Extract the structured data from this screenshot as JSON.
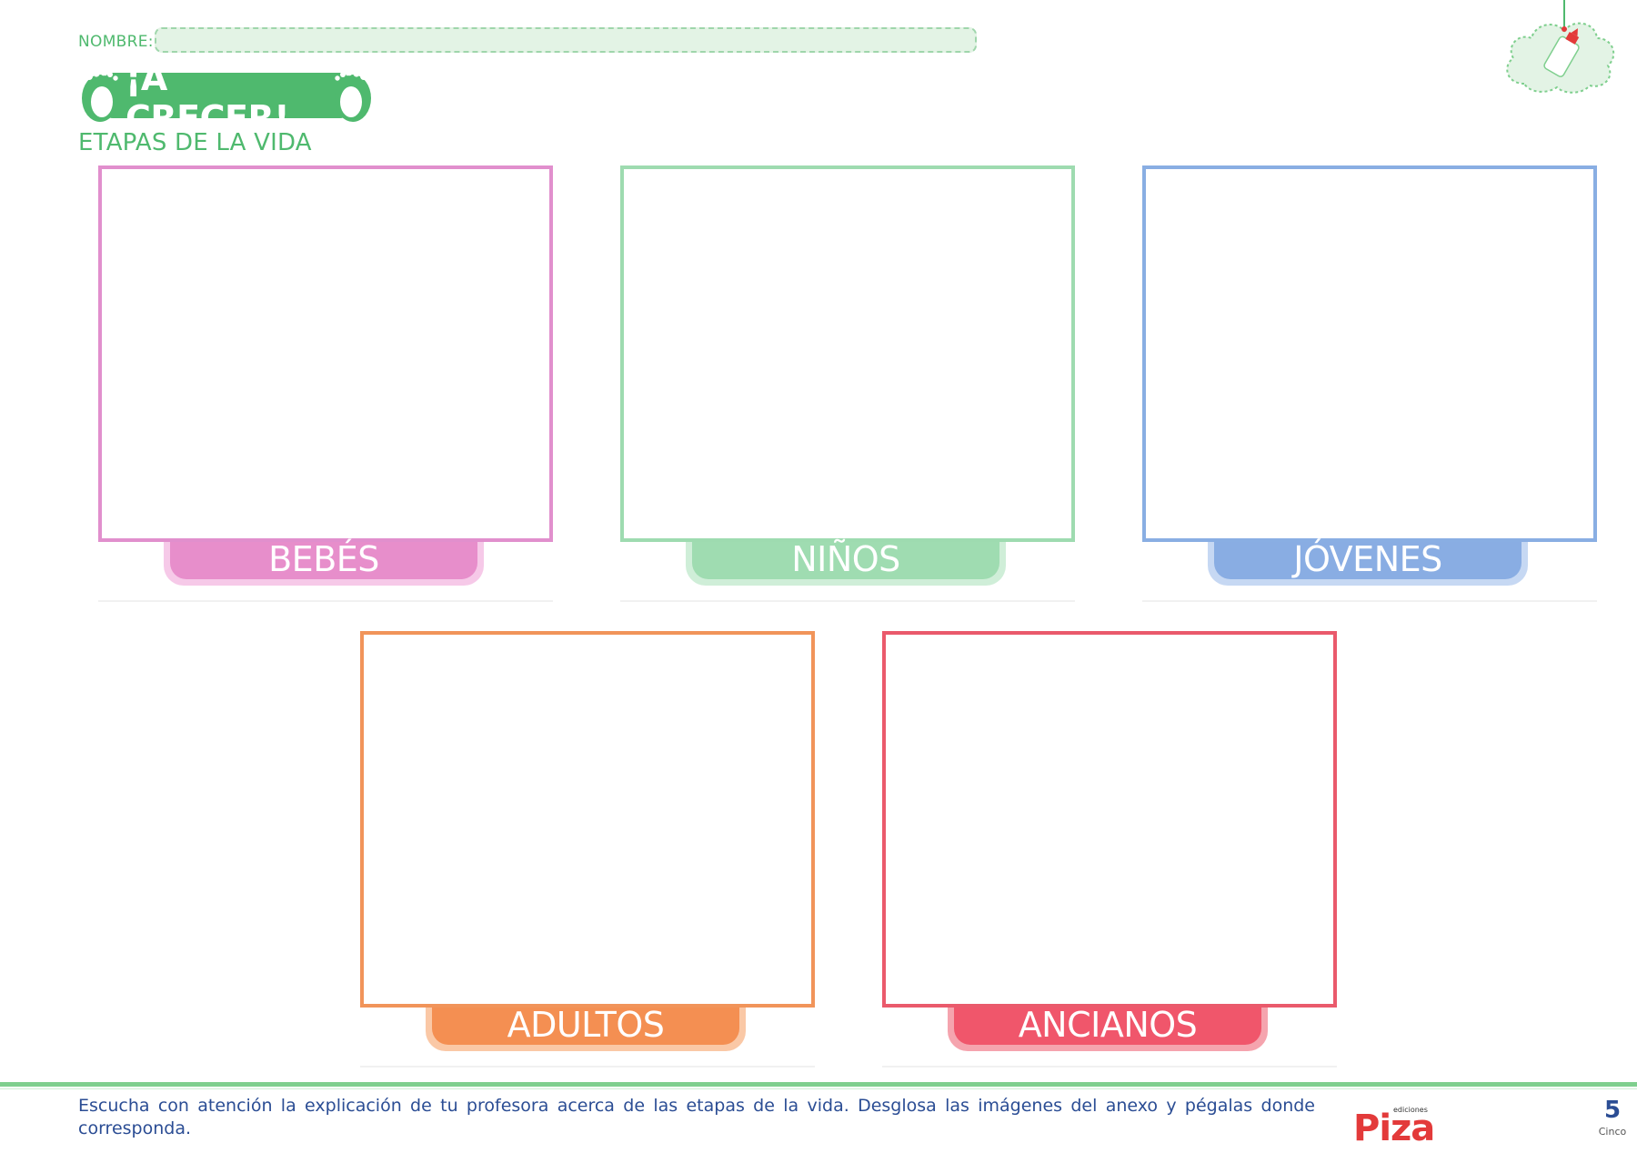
{
  "header": {
    "name_label": "NOMBRE:",
    "title": "¡A CRECER!",
    "subtitle": "ETAPAS DE LA VIDA"
  },
  "cards": [
    {
      "label": "BEBÉS",
      "color": "#e18fcd"
    },
    {
      "label": "NIÑOS",
      "color": "#9edbb0"
    },
    {
      "label": "JÓVENES",
      "color": "#89aee3"
    },
    {
      "label": "ADULTOS",
      "color": "#f1945a"
    },
    {
      "label": "ANCIANOS",
      "color": "#ea5a6c"
    }
  ],
  "footer": {
    "instructions": "Escucha con atención la explicación de tu profesora acerca de las etapas de la vida. Desglosa las imágenes del anexo y pégalas donde corresponda.",
    "publisher_small": "ediciones",
    "publisher": "Piza",
    "page_number": "5",
    "page_word": "Cinco"
  },
  "colors": {
    "accent_green": "#4fb96e",
    "footer_text": "#2b4d94",
    "logo_red": "#e33a3a"
  },
  "icons": [
    "footprint-icon",
    "cloud-glue-icon"
  ]
}
